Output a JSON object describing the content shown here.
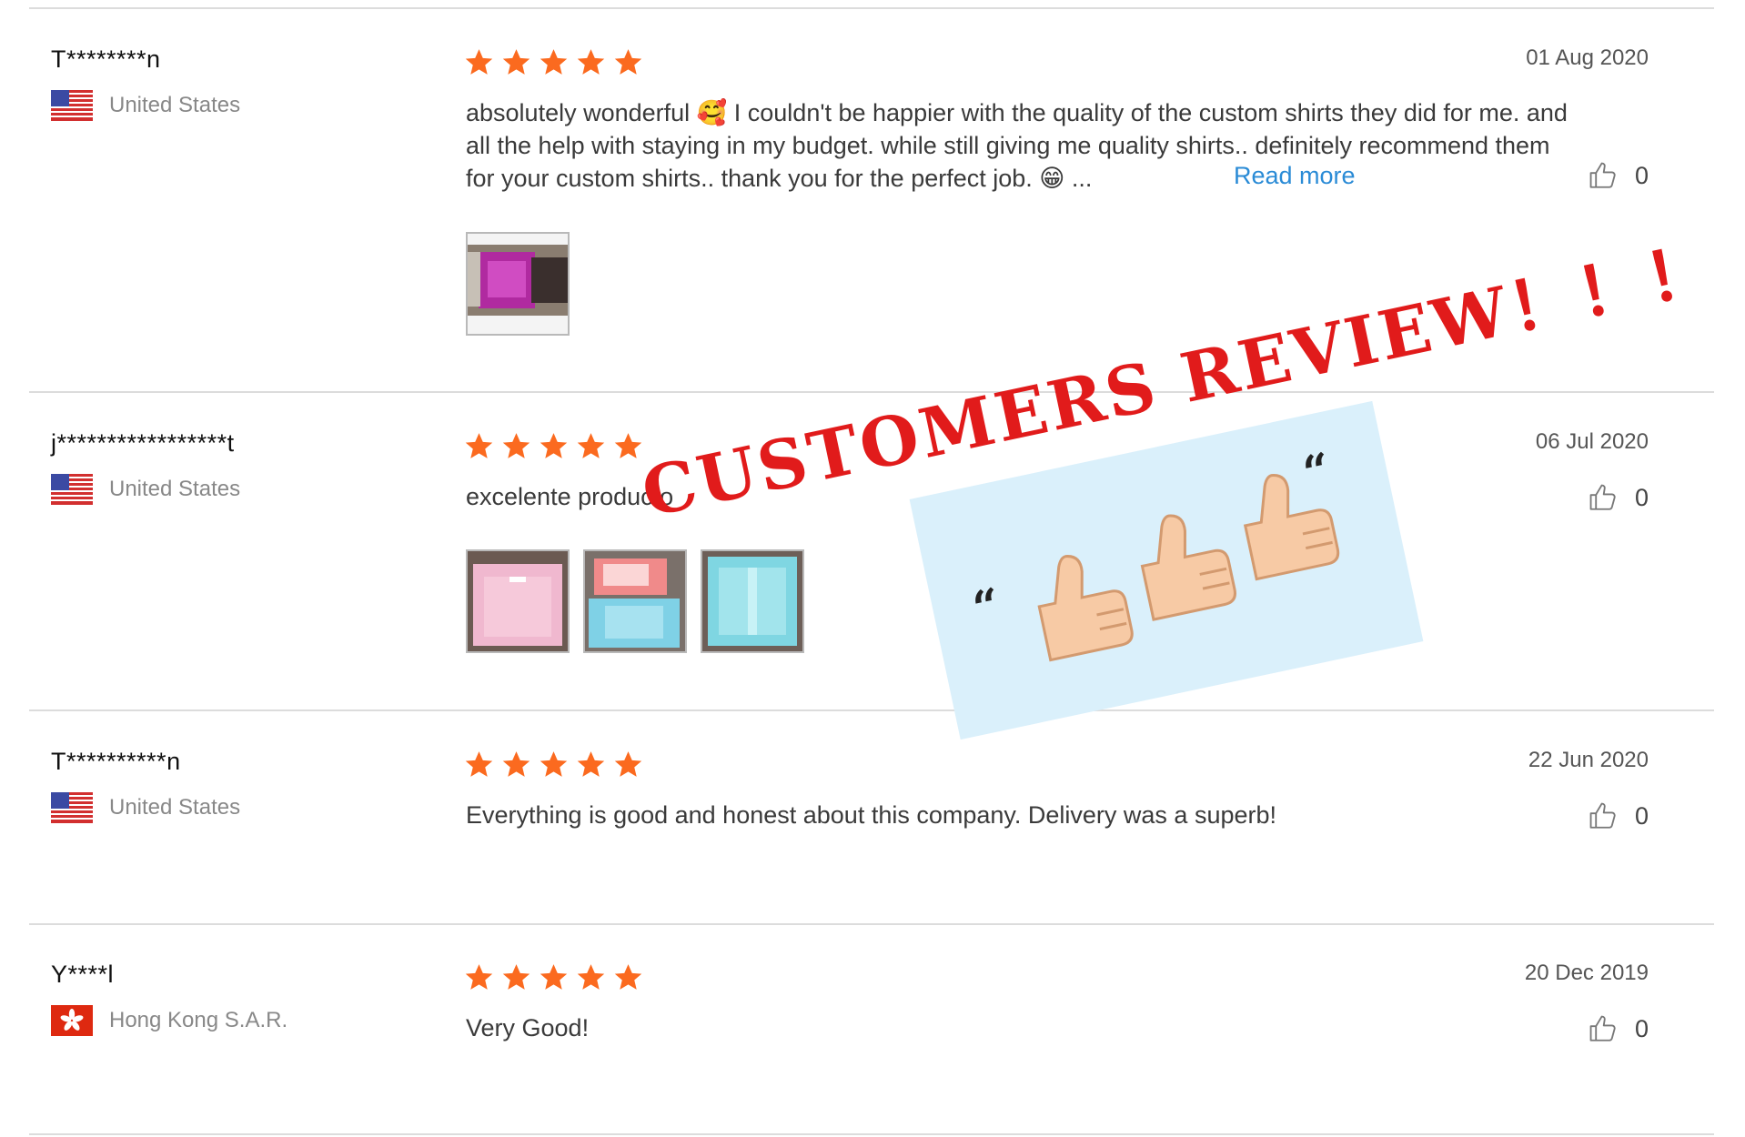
{
  "reviews": [
    {
      "user": "T********n",
      "country": "United States",
      "flag": "us-flag",
      "rating": 5,
      "date": "01 Aug 2020",
      "text_lines": [
        "absolutely wonderful 🥰 I couldn't be happier with the quality of the custom shirts they did for me. and",
        "all the help with staying in my budget.  while still giving me quality shirts.. definitely recommend them",
        "for your custom shirts..  thank you for the perfect job.  😁 ..."
      ],
      "read_more": "Read more",
      "likes": "0"
    },
    {
      "user": "j*****************t",
      "country": "United States",
      "flag": "us-flag",
      "rating": 5,
      "date": "06 Jul 2020",
      "text": "excelente producto",
      "likes": "0"
    },
    {
      "user": "T**********n",
      "country": "United States",
      "flag": "us-flag",
      "rating": 5,
      "date": "22 Jun 2020",
      "text": "Everything is good and honest about this company. Delivery was a superb!",
      "likes": "0"
    },
    {
      "user": "Y****l",
      "country": "Hong Kong S.A.R.",
      "flag": "hong-kong-flag",
      "rating": 5,
      "date": "20 Dec 2019",
      "text": "Very Good!",
      "likes": "0"
    }
  ],
  "overlay": {
    "title": "CUSTOMERS REVIEW！！！"
  },
  "colors": {
    "star": "#fb6a1f",
    "overlay_text": "#e11b1b",
    "link": "#2a8bd6",
    "card": "#daf0fb"
  }
}
